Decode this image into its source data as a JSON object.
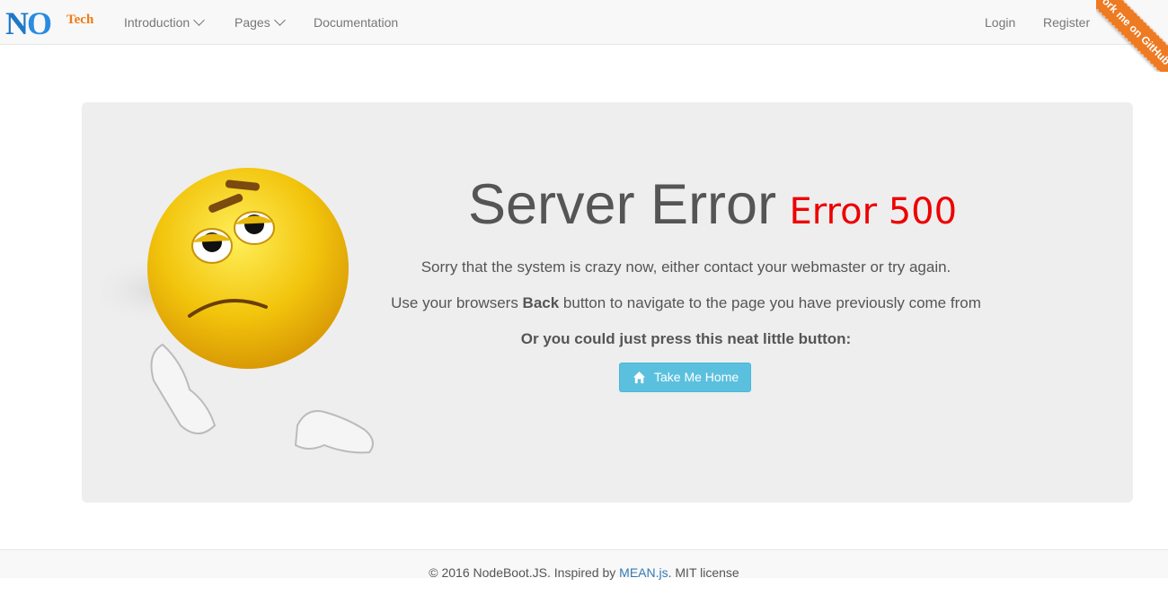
{
  "navbar": {
    "brand": {
      "n": "N",
      "o": "O",
      "tech": "Tech"
    },
    "items": [
      {
        "label": "Introduction",
        "dropdown": true
      },
      {
        "label": "Pages",
        "dropdown": true
      },
      {
        "label": "Documentation",
        "dropdown": false
      }
    ],
    "right": {
      "login": "Login",
      "register": "Register"
    },
    "ribbon": "Fork me on GitHub"
  },
  "error": {
    "title": "Server Error",
    "code": "Error 500",
    "message1": "Sorry that the system is crazy now, either contact your webmaster or try again.",
    "message2_pre": "Use your browsers ",
    "message2_bold": "Back",
    "message2_post": " button to navigate to the page you have previously come from",
    "message3": "Or you could just press this neat little button:",
    "button": "Take Me Home"
  },
  "footer": {
    "copyright": "© 2016 NodeBoot.JS. Inspired by ",
    "link": "MEAN.js",
    "license": ". MIT license"
  },
  "colors": {
    "accent": "#5bc0de",
    "error_red": "#ee0000",
    "ribbon": "#ee7a22"
  },
  "icons": [
    "chevron-down-icon",
    "home-icon",
    "sad-emoji-illustration"
  ]
}
